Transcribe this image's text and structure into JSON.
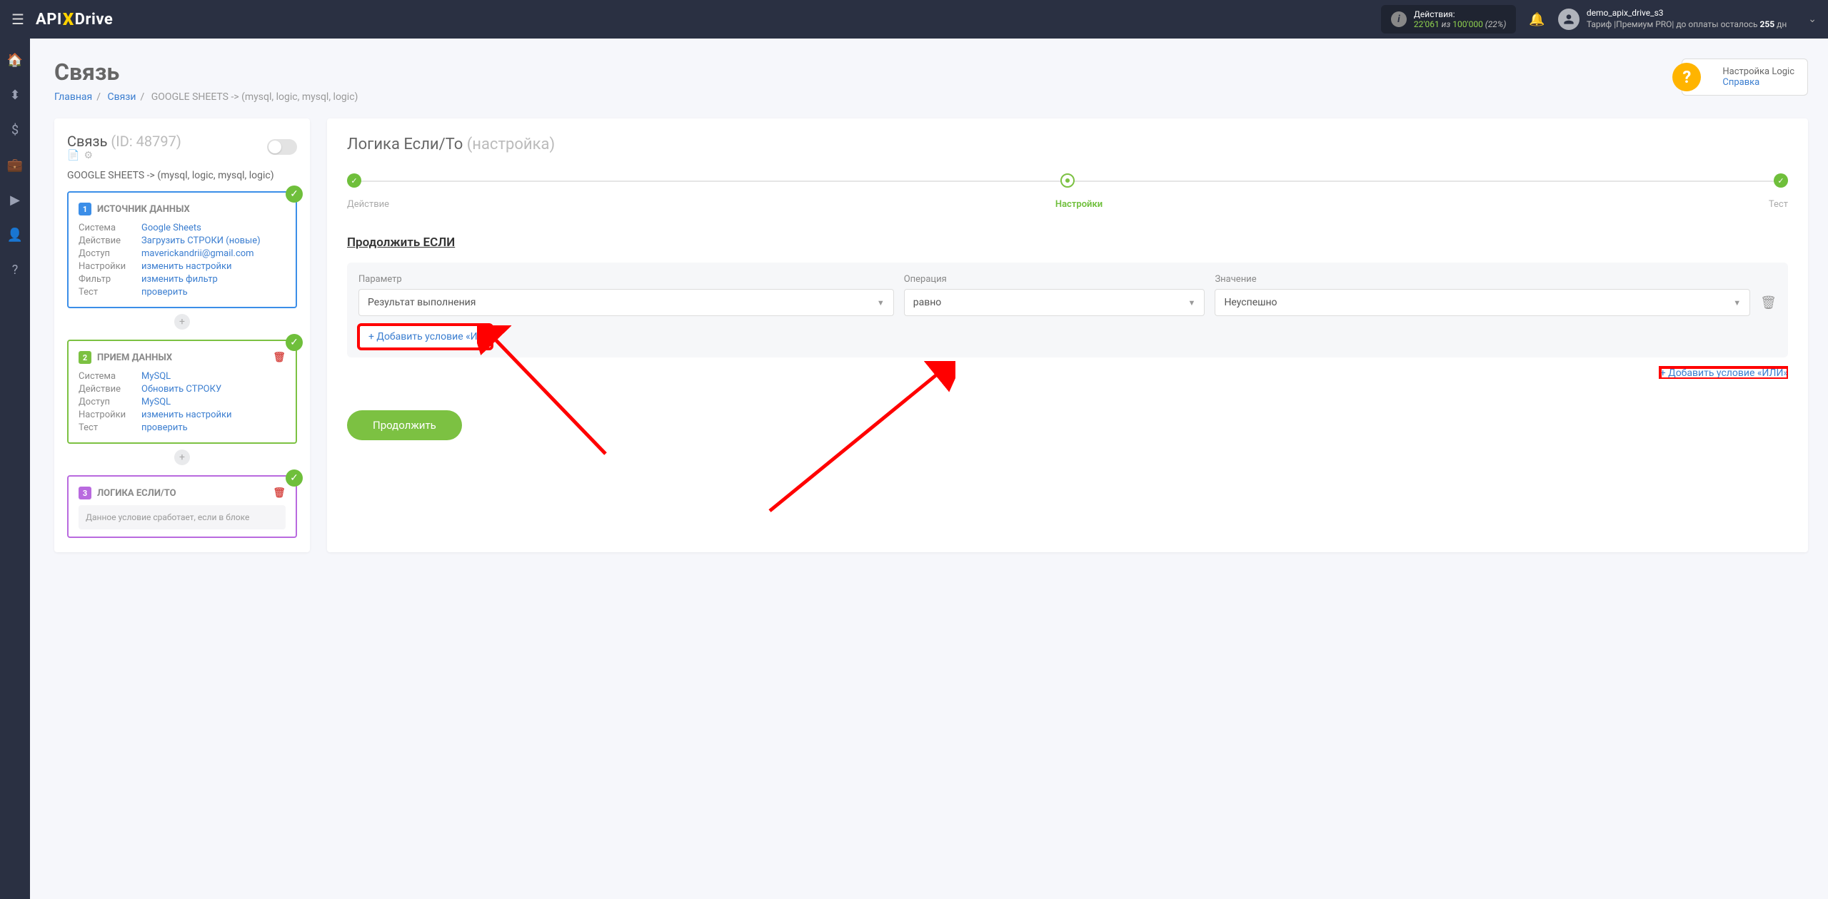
{
  "topbar": {
    "logo_pre": "API",
    "logo_post": "Drive",
    "actions_label": "Действия:",
    "actions_used": "22'061",
    "actions_of": " из ",
    "actions_total": "100'000",
    "actions_pct": " (22%)",
    "user_name": "demo_apix_drive_s3",
    "tariff_pre": "Тариф |Премиум PRO| до оплаты осталось ",
    "tariff_days": "255",
    "tariff_suf": " дн"
  },
  "page": {
    "title": "Связь",
    "crumbs": {
      "home": "Главная",
      "links": "Связи",
      "current": "GOOGLE SHEETS -> (mysql, logic, mysql, logic)"
    },
    "help_title": "Настройка Logic",
    "help_link": "Справка"
  },
  "sidebar": {
    "title": "Связь ",
    "id": "(ID: 48797)",
    "subtitle": "GOOGLE SHEETS -> (mysql, logic, mysql, logic)",
    "card1": {
      "title": "ИСТОЧНИК ДАННЫХ",
      "rows": [
        {
          "lbl": "Система",
          "val": "Google Sheets"
        },
        {
          "lbl": "Действие",
          "val": "Загрузить СТРОКИ (новые)"
        },
        {
          "lbl": "Доступ",
          "val": "maverickandrii@gmail.com"
        },
        {
          "lbl": "Настройки",
          "val": "изменить настройки"
        },
        {
          "lbl": "Фильтр",
          "val": "изменить фильтр"
        },
        {
          "lbl": "Тест",
          "val": "проверить"
        }
      ]
    },
    "card2": {
      "title": "ПРИЕМ ДАННЫХ",
      "rows": [
        {
          "lbl": "Система",
          "val": "MySQL"
        },
        {
          "lbl": "Действие",
          "val": "Обновить СТРОКУ"
        },
        {
          "lbl": "Доступ",
          "val": "MySQL"
        },
        {
          "lbl": "Настройки",
          "val": "изменить настройки"
        },
        {
          "lbl": "Тест",
          "val": "проверить"
        }
      ]
    },
    "card3": {
      "title": "ЛОГИКА ЕСЛИ/ТО",
      "note": "Данное условие сработает, если в блоке"
    }
  },
  "main": {
    "title": "Логика Если/То ",
    "title_sub": "(настройка)",
    "steps": {
      "s1": "Действие",
      "s2": "Настройки",
      "s3": "Тест"
    },
    "section": "Продолжить ЕСЛИ",
    "cond": {
      "param_lbl": "Параметр",
      "param_val": "Результат выполнения",
      "op_lbl": "Операция",
      "op_val": "равно",
      "val_lbl": "Значение",
      "val_val": "Неуспешно",
      "add_and": "+ Добавить условие «И»",
      "add_or": "+ Добавить условие «ИЛИ»"
    },
    "continue_btn": "Продолжить"
  }
}
